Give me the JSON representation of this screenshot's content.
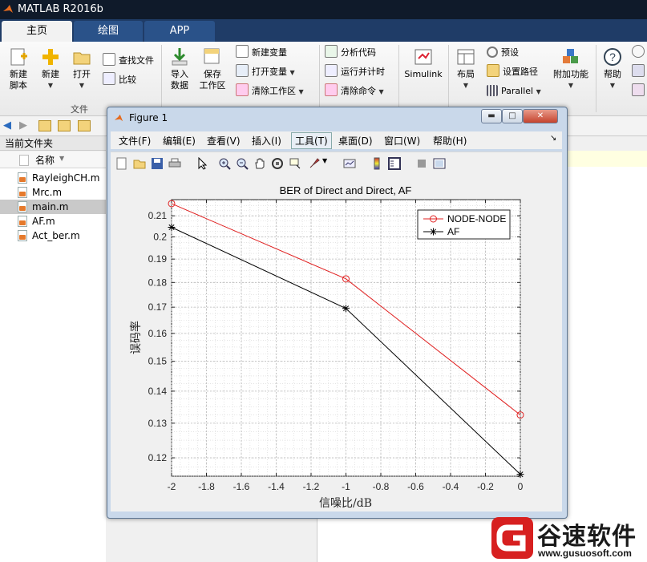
{
  "app": {
    "title": "MATLAB R2016b"
  },
  "tabs": [
    {
      "label": "主页"
    },
    {
      "label": "绘图"
    },
    {
      "label": "APP"
    }
  ],
  "ribbon": {
    "new_script": "新建\n脚本",
    "new": "新建",
    "open": "打开",
    "find_files": "查找文件",
    "compare": "比较",
    "import_data": "导入\n数据",
    "save_workspace": "保存\n工作区",
    "new_variable": "新建变量",
    "open_variable": "打开变量",
    "clear_workspace": "清除工作区",
    "analyze_code": "分析代码",
    "run_and_time": "运行并计时",
    "clear_commands": "清除命令",
    "simulink": "Simulink",
    "layout": "布局",
    "preferences": "预设",
    "set_path": "设置路径",
    "parallel": "Parallel",
    "addons": "附加功能",
    "help": "帮助",
    "group_file": "文件"
  },
  "left_panel": {
    "current_folder": "当前文件夹",
    "name_header": "名称",
    "files": [
      {
        "name": "RayleighCH.m"
      },
      {
        "name": "Mrc.m"
      },
      {
        "name": "main.m"
      },
      {
        "name": "AF.m"
      },
      {
        "name": "Act_ber.m"
      }
    ]
  },
  "figure": {
    "title": "Figure 1",
    "menu": [
      {
        "label": "文件(F)"
      },
      {
        "label": "编辑(E)"
      },
      {
        "label": "查看(V)"
      },
      {
        "label": "插入(I)"
      },
      {
        "label": "工具(T)"
      },
      {
        "label": "桌面(D)"
      },
      {
        "label": "窗口(W)"
      },
      {
        "label": "帮助(H)"
      }
    ],
    "toolbar_icons": [
      "new-figure-icon",
      "open-file-icon",
      "save-icon",
      "print-icon",
      "pointer-icon",
      "zoom-in-icon",
      "zoom-out-icon",
      "pan-hand-icon",
      "rotate-3d-icon",
      "data-cursor-icon",
      "brush-icon",
      "link-plot-icon",
      "insert-colorbar-icon",
      "insert-legend-icon",
      "hide-plot-tools-icon",
      "show-plot-tools-icon"
    ]
  },
  "chart_data": {
    "type": "line",
    "title": "BER of Direct and Direct, AF",
    "xlabel": "信噪比/dB",
    "ylabel": "误码率",
    "xlim": [
      -2,
      0
    ],
    "ylim": [
      0.115,
      0.218
    ],
    "y_scale": "log",
    "grid": "minor",
    "x_ticks": [
      "-2",
      "-1.8",
      "-1.6",
      "-1.4",
      "-1.2",
      "-1",
      "-0.8",
      "-0.6",
      "-0.4",
      "-0.2",
      "0"
    ],
    "y_ticks": [
      "0.12",
      "0.13",
      "0.14",
      "0.15",
      "0.16",
      "0.17",
      "0.18",
      "0.19",
      "0.2",
      "0.21"
    ],
    "x": [
      -2,
      -1,
      0
    ],
    "series": [
      {
        "name": "NODE-NODE",
        "color": "#e02020",
        "marker": "o",
        "values": [
          0.216,
          0.1815,
          0.1325
        ]
      },
      {
        "name": "AF",
        "color": "#000000",
        "marker": "*",
        "values": [
          0.2045,
          0.1695,
          0.1155
        ]
      }
    ],
    "legend": "top-right"
  },
  "watermark": {
    "text": "谷速软件",
    "url": "www.gusuosoft.com"
  }
}
